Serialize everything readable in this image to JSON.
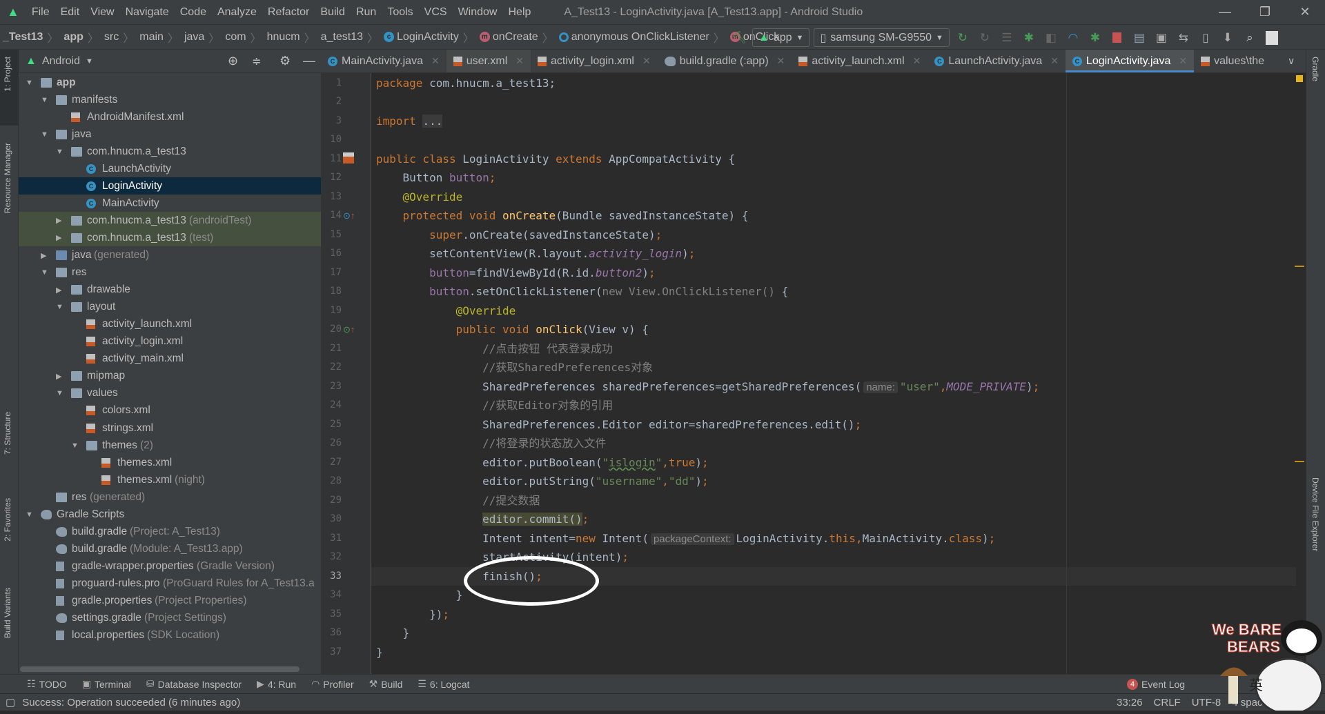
{
  "menubar": {
    "items": [
      "File",
      "Edit",
      "View",
      "Navigate",
      "Code",
      "Analyze",
      "Refactor",
      "Build",
      "Run",
      "Tools",
      "VCS",
      "Window",
      "Help"
    ],
    "title": "A_Test13 - LoginActivity.java [A_Test13.app] - Android Studio",
    "controls": [
      "—",
      "❐",
      "✕"
    ]
  },
  "breadcrumb": [
    {
      "label": "_Test13",
      "icon": "",
      "bold": true
    },
    {
      "label": "app",
      "icon": "",
      "bold": true
    },
    {
      "label": "src",
      "icon": ""
    },
    {
      "label": "main",
      "icon": ""
    },
    {
      "label": "java",
      "icon": ""
    },
    {
      "label": "com",
      "icon": ""
    },
    {
      "label": "hnucm",
      "icon": ""
    },
    {
      "label": "a_test13",
      "icon": ""
    },
    {
      "label": "LoginActivity",
      "icon": "c"
    },
    {
      "label": "onCreate",
      "icon": "m"
    },
    {
      "label": "anonymous OnClickListener",
      "icon": "o"
    },
    {
      "label": "onClick",
      "icon": "m"
    }
  ],
  "toolbar": {
    "run_config": "app",
    "device": "samsung SM-G9550",
    "icons": [
      "make-hammer-icon",
      "apply-changes-icon",
      "apply-code-changes-icon",
      "attach-debugger-icon",
      "debug-icon",
      "profile-icon",
      "run-coverage-icon",
      "attach-debugger-process-icon",
      "stop-icon",
      "project-structure-icon",
      "avd-manager-icon",
      "gradle-sync-icon",
      "device-manager-icon",
      "sdk-manager-icon",
      "search-icon",
      "account-icon"
    ]
  },
  "project": {
    "view_label": "Android",
    "tree": [
      {
        "label": "app",
        "depth": 0,
        "arrow": "open",
        "icon": "folder-module",
        "bold": true
      },
      {
        "label": "manifests",
        "depth": 1,
        "arrow": "open",
        "icon": "folder"
      },
      {
        "label": "AndroidManifest.xml",
        "depth": 2,
        "arrow": "",
        "icon": "manifest"
      },
      {
        "label": "java",
        "depth": 1,
        "arrow": "open",
        "icon": "folder"
      },
      {
        "label": "com.hnucm.a_test13",
        "depth": 2,
        "arrow": "open",
        "icon": "package"
      },
      {
        "label": "LaunchActivity",
        "depth": 3,
        "arrow": "",
        "icon": "class"
      },
      {
        "label": "LoginActivity",
        "depth": 3,
        "arrow": "",
        "icon": "class",
        "selected": true
      },
      {
        "label": "MainActivity",
        "depth": 3,
        "arrow": "",
        "icon": "class"
      },
      {
        "label": "com.hnucm.a_test13",
        "suffix": "(androidTest)",
        "depth": 2,
        "arrow": "closed",
        "icon": "package",
        "highlight": true
      },
      {
        "label": "com.hnucm.a_test13",
        "suffix": "(test)",
        "depth": 2,
        "arrow": "closed",
        "icon": "package",
        "highlight": true
      },
      {
        "label": "java",
        "suffix": "(generated)",
        "depth": 1,
        "arrow": "closed",
        "icon": "folder-src"
      },
      {
        "label": "res",
        "depth": 1,
        "arrow": "open",
        "icon": "folder"
      },
      {
        "label": "drawable",
        "depth": 2,
        "arrow": "closed",
        "icon": "package"
      },
      {
        "label": "layout",
        "depth": 2,
        "arrow": "open",
        "icon": "package"
      },
      {
        "label": "activity_launch.xml",
        "depth": 3,
        "arrow": "",
        "icon": "xml"
      },
      {
        "label": "activity_login.xml",
        "depth": 3,
        "arrow": "",
        "icon": "xml"
      },
      {
        "label": "activity_main.xml",
        "depth": 3,
        "arrow": "",
        "icon": "xml"
      },
      {
        "label": "mipmap",
        "depth": 2,
        "arrow": "closed",
        "icon": "package"
      },
      {
        "label": "values",
        "depth": 2,
        "arrow": "open",
        "icon": "package"
      },
      {
        "label": "colors.xml",
        "depth": 3,
        "arrow": "",
        "icon": "xml"
      },
      {
        "label": "strings.xml",
        "depth": 3,
        "arrow": "",
        "icon": "xml"
      },
      {
        "label": "themes",
        "suffix": "(2)",
        "depth": 3,
        "arrow": "open",
        "icon": "package"
      },
      {
        "label": "themes.xml",
        "depth": 4,
        "arrow": "",
        "icon": "xml"
      },
      {
        "label": "themes.xml",
        "suffix": "(night)",
        "depth": 4,
        "arrow": "",
        "icon": "xml"
      },
      {
        "label": "res",
        "suffix": "(generated)",
        "depth": 1,
        "arrow": "",
        "icon": "folder"
      },
      {
        "label": "Gradle Scripts",
        "depth": 0,
        "arrow": "open",
        "icon": "gradle"
      },
      {
        "label": "build.gradle",
        "suffix": "(Project: A_Test13)",
        "depth": 1,
        "arrow": "",
        "icon": "gradle"
      },
      {
        "label": "build.gradle",
        "suffix": "(Module: A_Test13.app)",
        "depth": 1,
        "arrow": "",
        "icon": "gradle"
      },
      {
        "label": "gradle-wrapper.properties",
        "suffix": "(Gradle Version)",
        "depth": 1,
        "arrow": "",
        "icon": "props"
      },
      {
        "label": "proguard-rules.pro",
        "suffix": "(ProGuard Rules for A_Test13.a",
        "depth": 1,
        "arrow": "",
        "icon": "props"
      },
      {
        "label": "gradle.properties",
        "suffix": "(Project Properties)",
        "depth": 1,
        "arrow": "",
        "icon": "props"
      },
      {
        "label": "settings.gradle",
        "suffix": "(Project Settings)",
        "depth": 1,
        "arrow": "",
        "icon": "gradle"
      },
      {
        "label": "local.properties",
        "suffix": "(SDK Location)",
        "depth": 1,
        "arrow": "",
        "icon": "props"
      }
    ]
  },
  "tabs": [
    {
      "label": "MainActivity.java",
      "icon": "class"
    },
    {
      "label": "user.xml",
      "icon": "xml",
      "hover": true
    },
    {
      "label": "activity_login.xml",
      "icon": "xml"
    },
    {
      "label": "build.gradle (:app)",
      "icon": "gradle"
    },
    {
      "label": "activity_launch.xml",
      "icon": "xml"
    },
    {
      "label": "LaunchActivity.java",
      "icon": "class"
    },
    {
      "label": "LoginActivity.java",
      "icon": "class",
      "active": true
    },
    {
      "label": "values\\the",
      "icon": "xml",
      "truncated": true
    }
  ],
  "left_strip": [
    "1: Project",
    "Resource Manager",
    "7: Structure",
    "2: Favorites",
    "Build Variants"
  ],
  "right_strip": [
    "Gradle",
    "Device File Explorer"
  ],
  "editor": {
    "current_line": 33,
    "lines": [
      {
        "n": 1,
        "tokens": [
          [
            "kw",
            "package "
          ],
          [
            "plain",
            "com.hnucm.a_test13;"
          ]
        ]
      },
      {
        "n": 2,
        "tokens": []
      },
      {
        "n": 3,
        "tokens": [
          [
            "kw",
            "import "
          ],
          [
            "fold",
            "..."
          ]
        ]
      },
      {
        "n": 10,
        "tokens": []
      },
      {
        "n": 11,
        "tokens": [
          [
            "kw",
            "public class "
          ],
          [
            "plain",
            "LoginActivity "
          ],
          [
            "kw",
            "extends "
          ],
          [
            "plain",
            "AppCompatActivity {"
          ]
        ]
      },
      {
        "n": 12,
        "tokens": [
          [
            "plain",
            "    Button "
          ],
          [
            "field",
            "button"
          ],
          [
            "kw",
            ";"
          ]
        ]
      },
      {
        "n": 13,
        "tokens": [
          [
            "ann",
            "    @Override"
          ]
        ]
      },
      {
        "n": 14,
        "tokens": [
          [
            "kw",
            "    protected void "
          ],
          [
            "fn",
            "onCreate"
          ],
          [
            "plain",
            "(Bundle savedInstanceState) {"
          ]
        ]
      },
      {
        "n": 15,
        "tokens": [
          [
            "kw",
            "        super"
          ],
          [
            "plain",
            ".onCreate(savedInstanceState)"
          ],
          [
            "kw",
            ";"
          ]
        ]
      },
      {
        "n": 16,
        "tokens": [
          [
            "plain",
            "        setContentView(R.layout."
          ],
          [
            "ifield",
            "activity_login"
          ],
          [
            "plain",
            ")"
          ],
          [
            "kw",
            ";"
          ]
        ]
      },
      {
        "n": 17,
        "tokens": [
          [
            "field",
            "        button"
          ],
          [
            "plain",
            "=findViewById(R.id."
          ],
          [
            "ifield",
            "button2"
          ],
          [
            "plain",
            ")"
          ],
          [
            "kw",
            ";"
          ]
        ]
      },
      {
        "n": 18,
        "tokens": [
          [
            "field",
            "        button"
          ],
          [
            "plain",
            ".setOnClickListener("
          ],
          [
            "dim",
            "new View.OnClickListener() "
          ],
          [
            "plain",
            "{"
          ]
        ]
      },
      {
        "n": 19,
        "tokens": [
          [
            "ann",
            "            @Override"
          ]
        ]
      },
      {
        "n": 20,
        "tokens": [
          [
            "kw",
            "            public void "
          ],
          [
            "fn",
            "onClick"
          ],
          [
            "plain",
            "(View v) {"
          ]
        ]
      },
      {
        "n": 21,
        "tokens": [
          [
            "cmt",
            "                //点击按钮 代表登录成功"
          ]
        ]
      },
      {
        "n": 22,
        "tokens": [
          [
            "cmt",
            "                //获取SharedPreferences对象"
          ]
        ]
      },
      {
        "n": 23,
        "tokens": [
          [
            "plain",
            "                SharedPreferences sharedPreferences=getSharedPreferences("
          ],
          [
            "hint",
            "name:"
          ],
          [
            "str",
            "\"user\""
          ],
          [
            "kw",
            ","
          ],
          [
            "ifield",
            "MODE_PRIVATE"
          ],
          [
            "plain",
            ")"
          ],
          [
            "kw",
            ";"
          ]
        ]
      },
      {
        "n": 24,
        "tokens": [
          [
            "cmt",
            "                //获取Editor对象的引用"
          ]
        ]
      },
      {
        "n": 25,
        "tokens": [
          [
            "plain",
            "                SharedPreferences.Editor editor=sharedPreferences.edit()"
          ],
          [
            "kw",
            ";"
          ]
        ]
      },
      {
        "n": 26,
        "tokens": [
          [
            "cmt",
            "                //将登录的状态放入文件"
          ]
        ]
      },
      {
        "n": 27,
        "tokens": [
          [
            "plain",
            "                editor.putBoolean("
          ],
          [
            "str",
            "\""
          ],
          [
            "warn",
            "islogin"
          ],
          [
            "str",
            "\""
          ],
          [
            "kw",
            ",true"
          ],
          [
            "plain",
            ")"
          ],
          [
            "kw",
            ";"
          ]
        ]
      },
      {
        "n": 28,
        "tokens": [
          [
            "plain",
            "                editor.putString("
          ],
          [
            "str",
            "\"username\""
          ],
          [
            "kw",
            ","
          ],
          [
            "str",
            "\"dd\""
          ],
          [
            "plain",
            ")"
          ],
          [
            "kw",
            ";"
          ]
        ]
      },
      {
        "n": 29,
        "tokens": [
          [
            "cmt",
            "                //提交数据"
          ]
        ]
      },
      {
        "n": 30,
        "tokens": [
          [
            "plain",
            "                "
          ],
          [
            "hi",
            "editor.commit()"
          ],
          [
            "kw",
            ";"
          ]
        ]
      },
      {
        "n": 31,
        "tokens": [
          [
            "plain",
            "                Intent intent="
          ],
          [
            "kw",
            "new "
          ],
          [
            "plain",
            "Intent("
          ],
          [
            "hint",
            "packageContext:"
          ],
          [
            "plain",
            "LoginActivity."
          ],
          [
            "kw",
            "this,"
          ],
          [
            "plain",
            "MainActivity."
          ],
          [
            "kw",
            "class"
          ],
          [
            "plain",
            ")"
          ],
          [
            "kw",
            ";"
          ]
        ]
      },
      {
        "n": 32,
        "tokens": [
          [
            "plain",
            "                startActivity(intent)"
          ],
          [
            "kw",
            ";"
          ]
        ]
      },
      {
        "n": 33,
        "tokens": [
          [
            "plain",
            "                finish()"
          ],
          [
            "kw",
            ";"
          ]
        ]
      },
      {
        "n": 34,
        "tokens": [
          [
            "plain",
            "            }"
          ]
        ]
      },
      {
        "n": 35,
        "tokens": [
          [
            "plain",
            "        })"
          ],
          [
            "kw",
            ";"
          ]
        ]
      },
      {
        "n": 36,
        "tokens": [
          [
            "plain",
            "    }"
          ]
        ]
      },
      {
        "n": 37,
        "tokens": [
          [
            "plain",
            "}"
          ]
        ]
      }
    ]
  },
  "bottom_tools": [
    {
      "label": "TODO",
      "icon": "list-icon"
    },
    {
      "label": "Terminal",
      "icon": "terminal-icon"
    },
    {
      "label": "Database Inspector",
      "icon": "database-icon"
    },
    {
      "label": "4: Run",
      "icon": "run-icon"
    },
    {
      "label": "Profiler",
      "icon": "profiler-icon"
    },
    {
      "label": "Build",
      "icon": "build-icon"
    },
    {
      "label": "6: Logcat",
      "icon": "logcat-icon"
    }
  ],
  "event_log": {
    "label": "Event Log",
    "count": "4"
  },
  "status": {
    "message": "Success: Operation succeeded (6 minutes ago)",
    "position": "33:26",
    "line_sep": "CRLF",
    "encoding": "UTF-8",
    "indent": "4 spaces"
  },
  "sticker": {
    "logo_text": "We BARE BEARS",
    "ime": "英"
  },
  "colors": {
    "accent": "#4a88c7",
    "keyword": "#cc7832",
    "string": "#6a8759",
    "annotation": "#bbb529",
    "field": "#9876aa",
    "function": "#ffc66d",
    "comment": "#808080",
    "android": "#3ddc84"
  }
}
